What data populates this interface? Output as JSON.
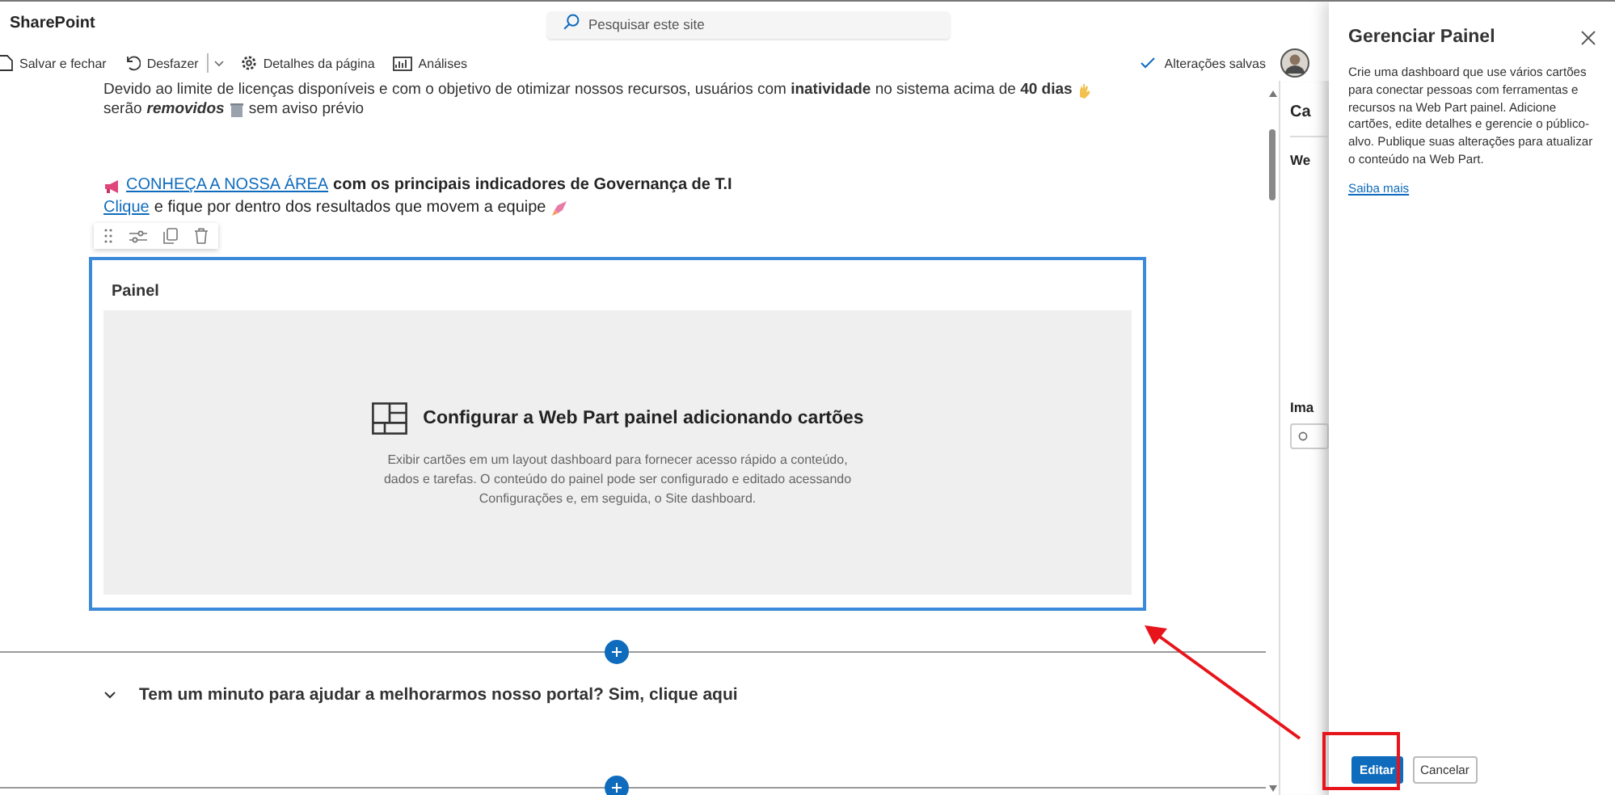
{
  "app": {
    "title": "SharePoint"
  },
  "search": {
    "placeholder": "Pesquisar este site"
  },
  "toolbar": [
    {
      "label": "Salvar e fechar",
      "kind": "save"
    },
    {
      "label": "Desfazer",
      "kind": "undo"
    },
    {
      "label": "Detalhes da página",
      "kind": "details"
    },
    {
      "label": "Análises",
      "kind": "analytics"
    }
  ],
  "save_status": "Alterações salvas",
  "notice": {
    "line_1": "Devido ao limite de licenças disponíveis e com o objetivo de otimizar nossos recursos, usuários com **inatividade** no sistema acima de **40 dias**",
    "line_2a": "serão",
    "line_2b": "removidos",
    "line_2c": "sem aviso prévio"
  },
  "highlight": {
    "link": "CONHEÇA A NOSSA ÁREA",
    "text": "com os principais indicadores de Governança de T.I",
    "link_2": "Clique",
    "text_2": "e fique por dentro dos resultados que movem a equipe"
  },
  "webpart": {
    "title": "Painel",
    "selected": true,
    "heading": "Configurar a Web Part painel adicionando cartões",
    "description": "Exibir cartões em um layout dashboard para fornecer acesso rápido a conteúdo, dados e tarefas. O conteúdo do painel pode ser configurado e editado acessando Configurações e, em seguida, o Site dashboard."
  },
  "section": {
    "title": "Tem um minuto para ajudar a melhorarmos nosso portal? Sim, clique aqui"
  },
  "property_pane": {
    "heading": "Ca",
    "label_1": "We",
    "label_2": "Ima"
  },
  "panel": {
    "title": "Gerenciar Painel",
    "description": "Crie uma dashboard que use vários cartões para conectar pessoas com ferramentas e recursos na Web Part painel. Adicione cartões, edite detalhes e gerencie o público-alvo. Publique suas alterações para atualizar o conteúdo na Web Part.",
    "link": "Saiba mais",
    "buttons": [
      {
        "label": "Editar",
        "kind": "primary"
      },
      {
        "label": "Cancelar",
        "kind": "secondary"
      }
    ]
  }
}
